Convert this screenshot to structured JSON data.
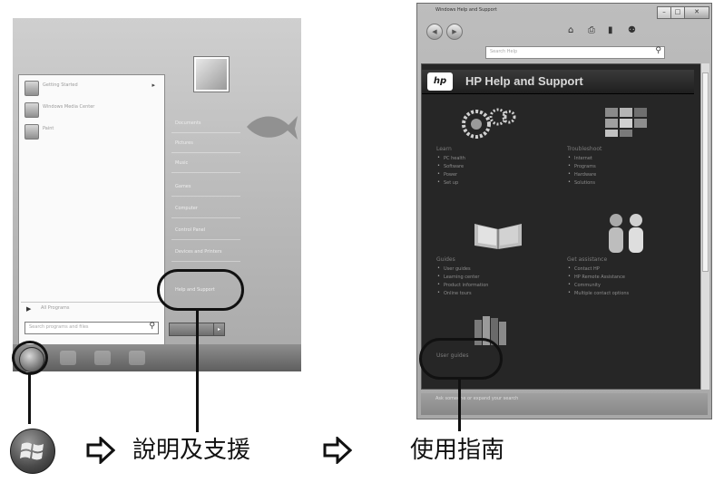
{
  "start_menu": {
    "programs": [
      "Getting Started",
      "Windows Media Center",
      "Paint"
    ],
    "all_programs": "All Programs",
    "search_placeholder": "Search programs and files",
    "right_items": [
      "Documents",
      "Pictures",
      "Music",
      "Games",
      "Computer",
      "Control Panel",
      "Devices and Printers",
      "Help and Support"
    ]
  },
  "help_window": {
    "title": "Windows Help and Support",
    "search_placeholder": "Search Help",
    "header": "HP Help and Support",
    "sections": {
      "learn": {
        "title": "Learn",
        "items": [
          "PC health",
          "Software",
          "Power",
          "Set up"
        ]
      },
      "troubleshoot": {
        "title": "Troubleshoot",
        "items": [
          "Internet",
          "Programs",
          "Hardware",
          "Solutions"
        ]
      },
      "guides": {
        "title": "Guides",
        "items": [
          "User guides",
          "Learning center",
          "Product information",
          "Online tours"
        ]
      },
      "assistance": {
        "title": "Get assistance",
        "items": [
          "Contact HP",
          "HP Remote Assistance",
          "Community",
          "Multiple contact options"
        ]
      },
      "user_guides": {
        "title": "User guides"
      }
    },
    "status": "Ask someone or expand your search"
  },
  "captions": {
    "help_and_support": "說明及支援",
    "user_guide": "使用指南"
  }
}
